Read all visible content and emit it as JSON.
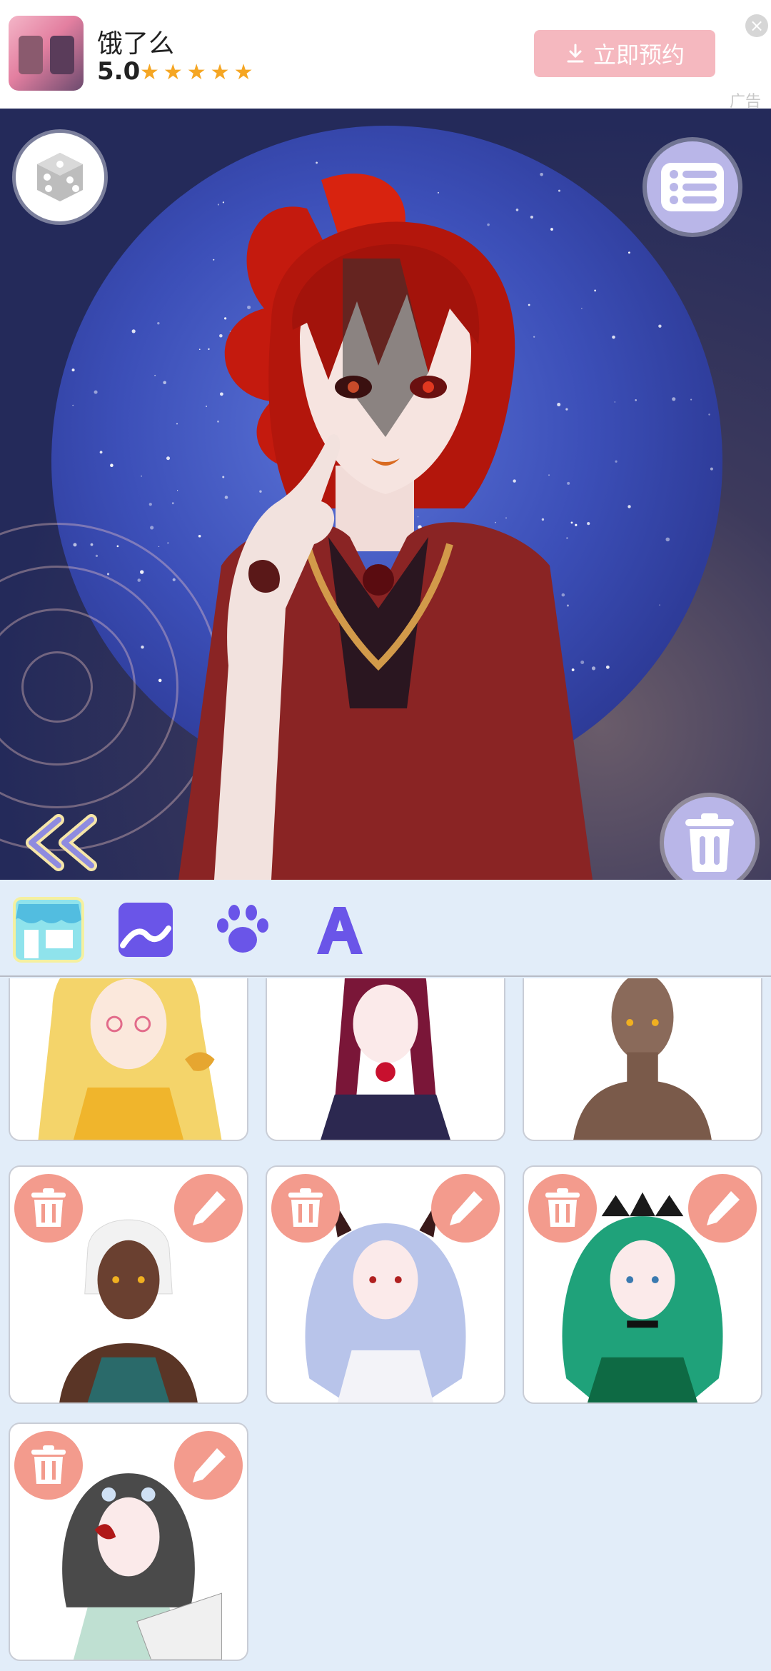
{
  "ad": {
    "title": "饿了么",
    "rating": "5.0",
    "stars": "★★★★★",
    "cta_label": "立即预约",
    "cta_icon": "download-icon",
    "tag": "广告",
    "close_icon": "close-icon"
  },
  "stage": {
    "dice_icon": "dice-icon",
    "menu_icon": "list-icon",
    "trash_icon": "trash-icon",
    "back_icon": "double-chevron-left-icon"
  },
  "tabs": [
    {
      "name": "shop",
      "icon": "store-icon"
    },
    {
      "name": "background",
      "icon": "picture-icon"
    },
    {
      "name": "pets",
      "icon": "paw-icon"
    },
    {
      "name": "text",
      "icon": "letter-a-icon"
    }
  ],
  "colors": {
    "accent": "#6a55e8",
    "button_pink": "#f39b8d",
    "stage_button": "#b9b6e8",
    "panel_bg": "#e2edf9"
  },
  "saved_characters": [
    {
      "label": "blonde character with bird"
    },
    {
      "label": "burgundy braids character with rose"
    },
    {
      "label": "blank base character"
    },
    {
      "label": "white hair dark skin character"
    },
    {
      "label": "lavender hair demon horns character"
    },
    {
      "label": "green hair crown character"
    },
    {
      "label": "dark hair character with fan"
    }
  ]
}
